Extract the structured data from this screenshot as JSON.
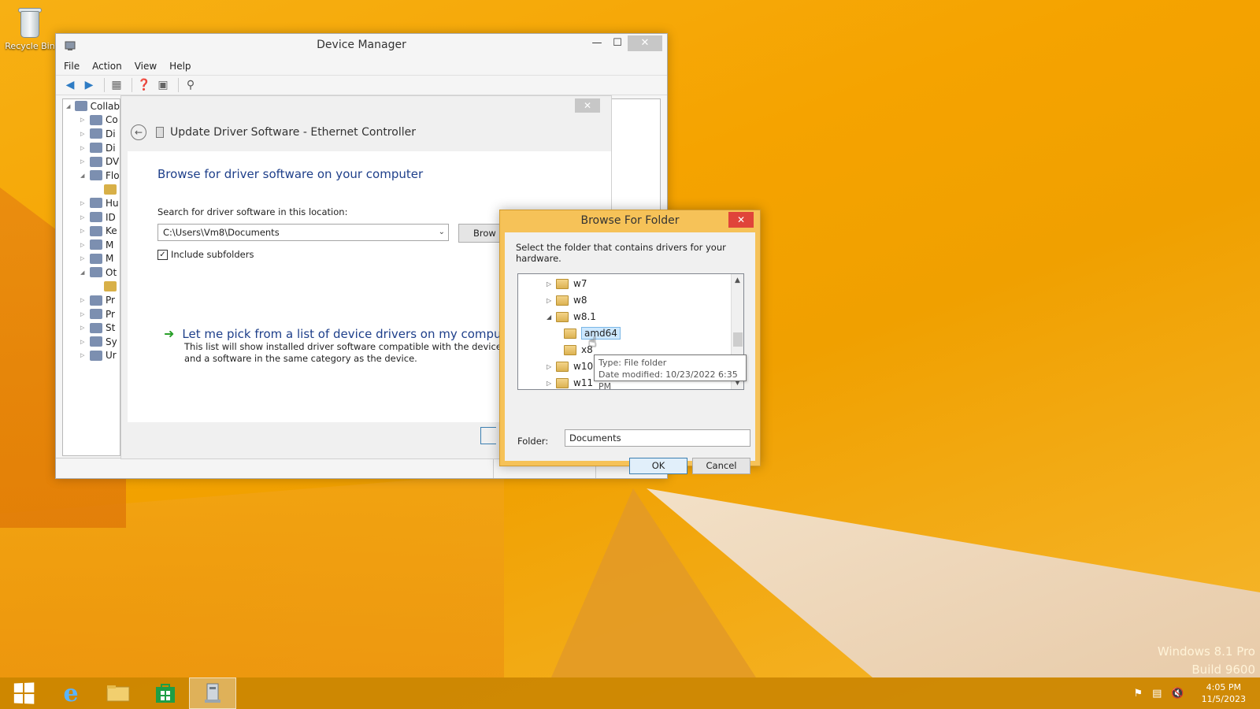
{
  "desktop": {
    "recycle_bin_label": "Recycle Bin"
  },
  "watermark": {
    "line1": "Windows 8.1 Pro",
    "line2": "Build 9600"
  },
  "device_manager": {
    "title": "Device Manager",
    "menu": [
      "File",
      "Action",
      "View",
      "Help"
    ],
    "tree": [
      {
        "label": "Collab",
        "expanded": true,
        "level": 0
      },
      {
        "label": "Co",
        "level": 1
      },
      {
        "label": "Di",
        "level": 1
      },
      {
        "label": "Di",
        "level": 1
      },
      {
        "label": "DV",
        "level": 1
      },
      {
        "label": "Flo",
        "level": 1,
        "expanded": true
      },
      {
        "label": "",
        "level": 2
      },
      {
        "label": "Hu",
        "level": 1
      },
      {
        "label": "ID",
        "level": 1
      },
      {
        "label": "Ke",
        "level": 1
      },
      {
        "label": "M",
        "level": 1
      },
      {
        "label": "M",
        "level": 1
      },
      {
        "label": "Ot",
        "level": 1,
        "expanded": true
      },
      {
        "label": "",
        "level": 2
      },
      {
        "label": "Pr",
        "level": 1
      },
      {
        "label": "Pr",
        "level": 1
      },
      {
        "label": "St",
        "level": 1
      },
      {
        "label": "Sy",
        "level": 1
      },
      {
        "label": "Ur",
        "level": 1
      }
    ]
  },
  "wizard": {
    "header": "Update Driver Software - Ethernet Controller",
    "heading": "Browse for driver software on your computer",
    "search_label": "Search for driver software in this location:",
    "path_value": "C:\\Users\\Vm8\\Documents",
    "browse_label": "Brow",
    "include_subfolders": "Include subfolders",
    "pick_link": "Let me pick from a list of device drivers on my computer",
    "pick_desc": "This list will show installed driver software compatible with the device, and a software in the same category as the device."
  },
  "browse_folder": {
    "title": "Browse For Folder",
    "description": "Select the folder that contains drivers for your hardware.",
    "tree": [
      {
        "label": "w7",
        "level": 0,
        "collapsed": true
      },
      {
        "label": "w8",
        "level": 0,
        "collapsed": true
      },
      {
        "label": "w8.1",
        "level": 0,
        "expanded": true
      },
      {
        "label": "amd64",
        "level": 1,
        "selected": true
      },
      {
        "label": "x8",
        "level": 1
      },
      {
        "label": "w10",
        "level": 0,
        "collapsed": true
      },
      {
        "label": "w11",
        "level": 0,
        "collapsed": true
      }
    ],
    "tooltip_type": "Type: File folder",
    "tooltip_date": "Date modified: 10/23/2022 6:35 PM",
    "folder_label": "Folder:",
    "folder_value": "Documents",
    "ok_label": "OK",
    "cancel_label": "Cancel"
  },
  "taskbar": {
    "time": "4:05 PM",
    "date": "11/5/2023"
  }
}
